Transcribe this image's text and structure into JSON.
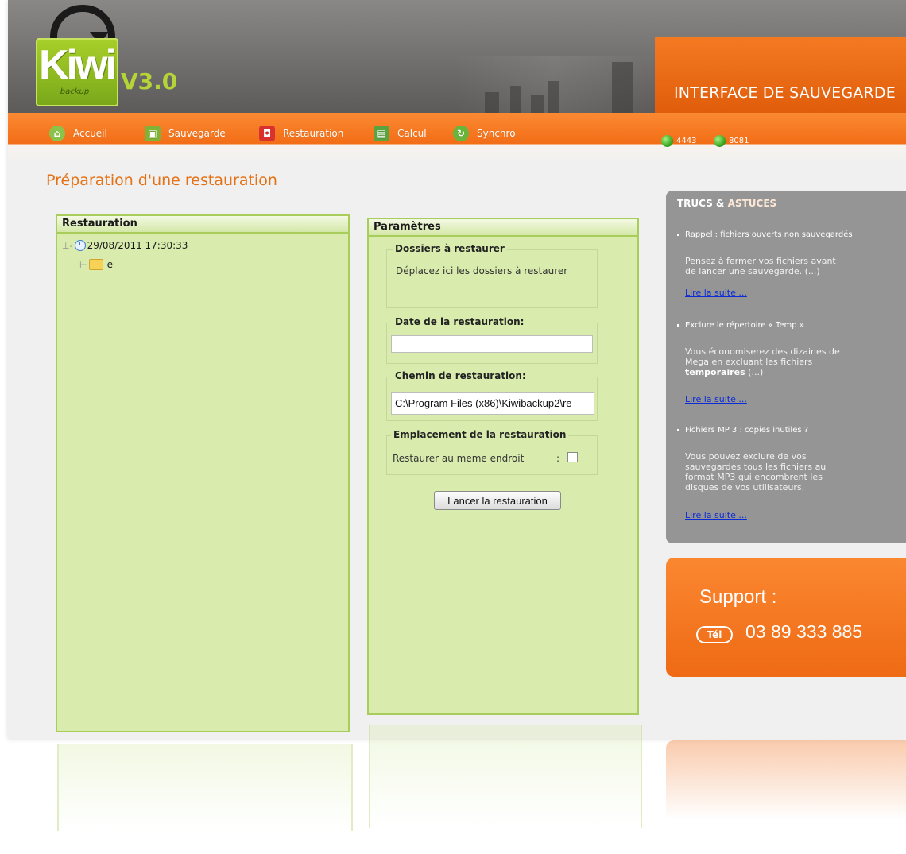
{
  "brand": {
    "logo_text": "Kiwi",
    "logo_sub": "backup",
    "version": "V3.0",
    "app_title": "INTERFACE DE SAUVEGARDE"
  },
  "nav": [
    {
      "label": "Accueil",
      "icon": "home-icon",
      "color": "#8bc34a"
    },
    {
      "label": "Sauvegarde",
      "icon": "backup-icon",
      "color": "#7fb236"
    },
    {
      "label": "Restauration",
      "icon": "restore-icon",
      "color": "#d9322e"
    },
    {
      "label": "Calcul",
      "icon": "calculator-icon",
      "color": "#5aa33f"
    },
    {
      "label": "Synchro",
      "icon": "sync-icon",
      "color": "#69b53b"
    }
  ],
  "status": [
    {
      "label": "4443",
      "color": "#2c9d16"
    },
    {
      "label": "8081",
      "color": "#2c9d16"
    }
  ],
  "page_title": "Préparation d'une restauration",
  "restore_panel": {
    "title": "Restauration",
    "tree": [
      {
        "label": "29/08/2011 17:30:33",
        "icon": "clock-icon"
      },
      {
        "label": "e",
        "icon": "folder-icon"
      }
    ]
  },
  "params_panel": {
    "title": "Paramètres",
    "folders_group": {
      "label": "Dossiers à restaurer",
      "text": "Déplacez ici les dossiers à restaurer"
    },
    "date_group": {
      "label": "Date de la restauration:",
      "value": ""
    },
    "path_group": {
      "label": "Chemin de restauration:",
      "value": "C:\\Program Files (x86)\\Kiwibackup2\\re"
    },
    "location_group": {
      "label": "Emplacement de la restauration",
      "checkbox_label": "Restaurer au meme endroit",
      "separator": ":",
      "checked": false
    },
    "submit_label": "Lancer la restauration"
  },
  "tips": {
    "title_part1": "TRUCS &",
    "title_part2": "ASTUCES",
    "items": [
      {
        "heading": "Rappel : fichiers ouverts non sauvegardés",
        "body": "Pensez à fermer vos fichiers avant de lancer une sauvegarde. (...)",
        "link": "Lire la suite ..."
      },
      {
        "heading": "Exclure le répertoire « Temp »",
        "body_before": "Vous économiserez des dizaines de Mega en excluant les fichiers",
        "body_bold": "temporaires",
        "body_after": " (...)",
        "link": "Lire la suite ..."
      },
      {
        "heading": "Fichiers MP 3 : copies inutiles ?",
        "body": "Vous pouvez exclure de vos sauvegardes tous les fichiers au format MP3 qui encombrent les disques de vos utilisateurs.",
        "link": "Lire la suite ..."
      }
    ]
  },
  "support": {
    "label": "Support :",
    "tel_badge": "Tél",
    "phone": "03 89 333 885"
  },
  "colors": {
    "accent_orange": "#f26d16",
    "panel_green": "#d9ecae",
    "brand_green": "#a7cf2a",
    "sidebar_grey": "#959595"
  }
}
